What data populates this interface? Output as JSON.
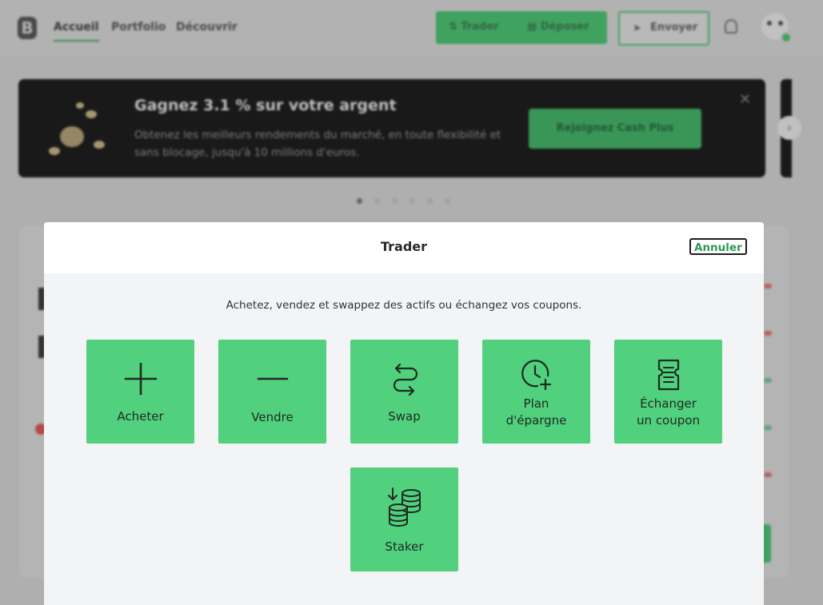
{
  "app": {
    "nav": {
      "home": "Accueil",
      "portfolio": "Portfolio",
      "discover": "Découvrir"
    },
    "header_buttons": {
      "trade": "Trader",
      "deposit": "Déposer",
      "send": "Envoyer"
    },
    "banner": {
      "title": "Gagnez 3.1 % sur votre argent",
      "text": "Obtenez les meilleurs rendements du marché, en toute flexibilité et sans blocage, jusqu'à 10 millions d'euros.",
      "cta": "Rejoignez Cash Plus"
    }
  },
  "modal": {
    "title": "Trader",
    "cancel_label": "Annuler",
    "description": "Achetez, vendez et swappez des actifs ou échangez vos coupons.",
    "actions": [
      {
        "label": "Acheter",
        "icon": "plus-icon"
      },
      {
        "label": "Vendre",
        "icon": "minus-icon"
      },
      {
        "label": "Swap",
        "icon": "swap-arrows-icon"
      },
      {
        "label_line1": "Plan",
        "label_line2": "d'épargne",
        "icon": "clock-plus-icon"
      },
      {
        "label_line1": "Échanger",
        "label_line2": "un coupon",
        "icon": "receipt-icon"
      },
      {
        "label": "Staker",
        "icon": "coin-stack-icon"
      }
    ]
  },
  "colors": {
    "accent_green": "#51d07e",
    "link_green": "#2e9a55",
    "banner_dark": "#1f1f1f"
  }
}
